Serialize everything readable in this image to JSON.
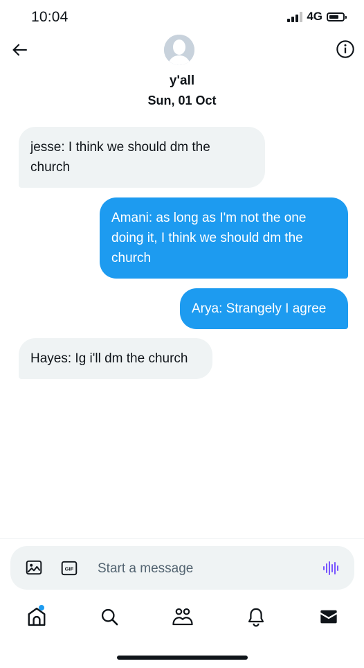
{
  "status_bar": {
    "time": "10:04",
    "network": "4G"
  },
  "header": {
    "title": "y'all",
    "date": "Sun, 01 Oct",
    "back_icon": "arrow-left-icon",
    "info_icon": "info-icon"
  },
  "messages": [
    {
      "direction": "in",
      "text": "jesse: I think we should dm the church"
    },
    {
      "direction": "out",
      "text": "Amani:  as  long as I'm not the one doing it, I think we should dm the church"
    },
    {
      "direction": "out",
      "text": "Arya: Strangely I agree"
    },
    {
      "direction": "in",
      "text": "Hayes: Ig i'll dm the church"
    }
  ],
  "composer": {
    "placeholder": "Start a message",
    "media_icon": "image-icon",
    "gif_label": "GIF",
    "voice_icon": "voice-waveform-icon"
  },
  "tabs": [
    {
      "name": "home",
      "icon": "home-icon",
      "has_notification_dot": true
    },
    {
      "name": "search",
      "icon": "search-icon"
    },
    {
      "name": "communities",
      "icon": "communities-icon"
    },
    {
      "name": "notifications",
      "icon": "bell-icon"
    },
    {
      "name": "messages",
      "icon": "mail-icon",
      "active": true
    }
  ],
  "colors": {
    "accent": "#1d9bf0",
    "incoming_bubble": "#eff3f4",
    "text": "#0f1419",
    "muted": "#536471",
    "voice": "#7856ff"
  }
}
